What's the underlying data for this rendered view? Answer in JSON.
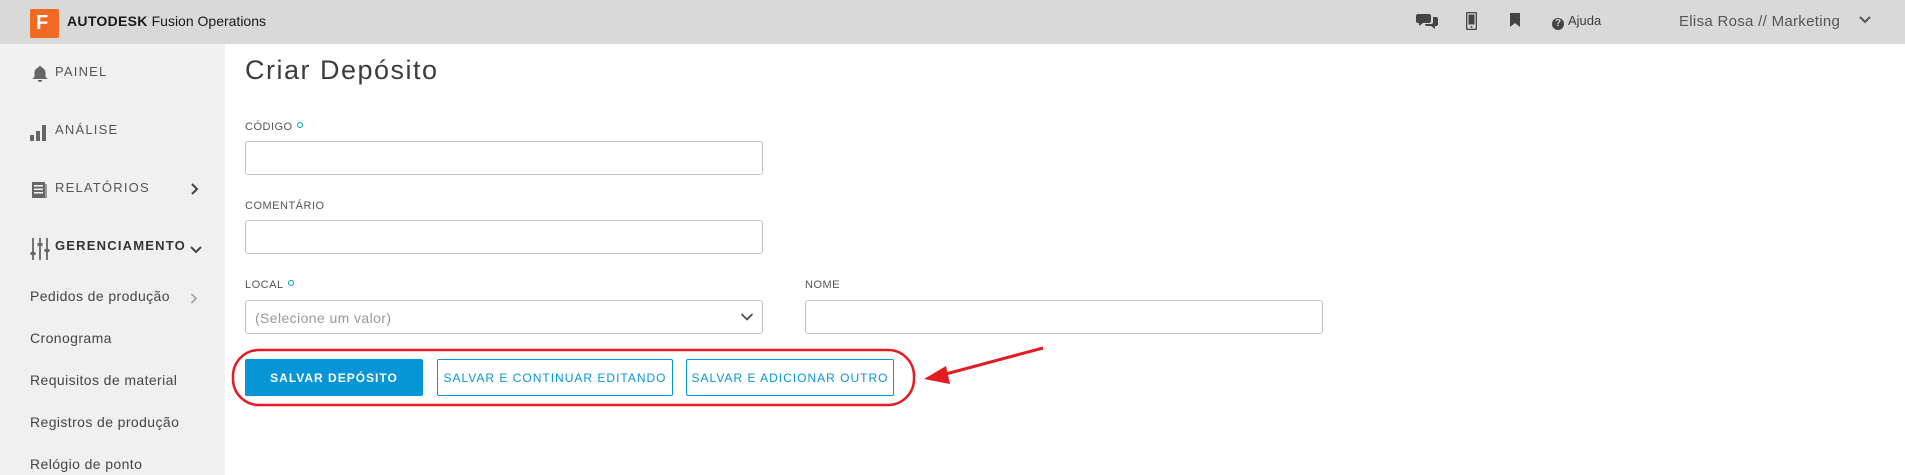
{
  "header": {
    "logo_letter": "F",
    "brand_bold": "AUTODESK",
    "brand_rest": " Fusion Operations",
    "help_label": "Ajuda",
    "user_label": "Elisa Rosa // Marketing",
    "icons": [
      "chat-icon",
      "mobile-icon",
      "bookmark-icon",
      "help-icon",
      "chevron-down-icon"
    ]
  },
  "sidebar": {
    "items": [
      {
        "label": "PAINEL",
        "icon": "bell-icon"
      },
      {
        "label": "ANÁLISE",
        "icon": "bar-chart-icon"
      },
      {
        "label": "RELATÓRIOS",
        "icon": "report-icon"
      },
      {
        "label": "GERENCIAMENTO",
        "icon": "sliders-icon"
      }
    ],
    "subitems": [
      {
        "label": "Pedidos de produção"
      },
      {
        "label": "Cronograma"
      },
      {
        "label": "Requisitos de material"
      },
      {
        "label": "Registros de produção"
      },
      {
        "label": "Relógio de ponto"
      }
    ]
  },
  "main": {
    "title": "Criar Depósito",
    "fields": {
      "codigo_label": "CÓDIGO",
      "comentario_label": "COMENTÁRIO",
      "local_label": "LOCAL",
      "local_placeholder": "(Selecione um valor)",
      "nome_label": "NOME"
    },
    "buttons": {
      "save": "SALVAR DEPÓSITO",
      "save_continue": "SALVAR E CONTINUAR EDITANDO",
      "save_add": "SALVAR E ADICIONAR OUTRO"
    }
  },
  "colors": {
    "accent": "#0696d7",
    "brand": "#f26a21",
    "annotation": "#e31b23"
  }
}
